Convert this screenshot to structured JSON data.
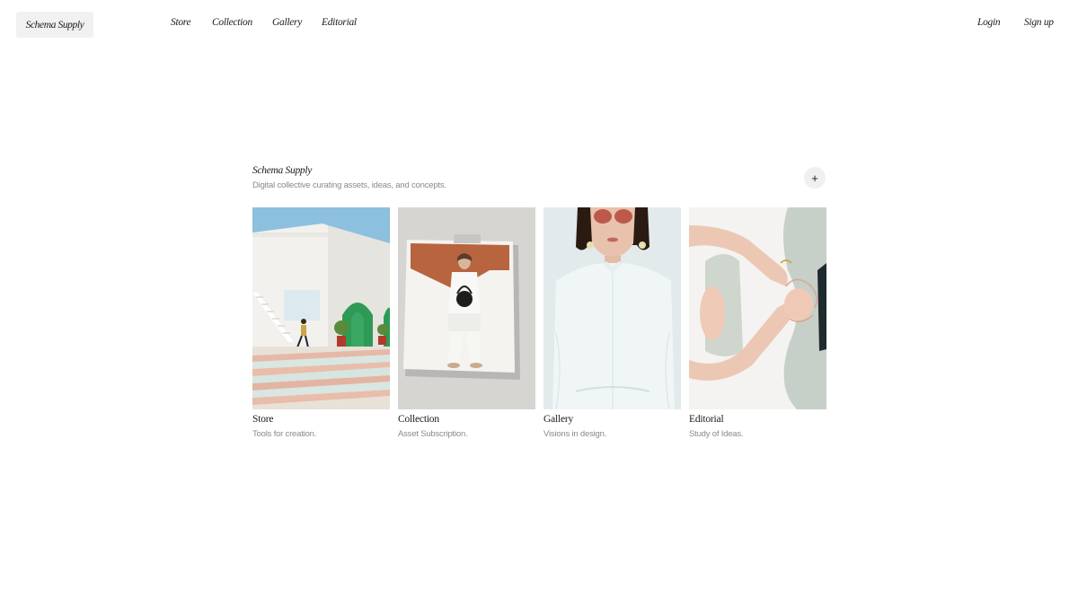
{
  "header": {
    "logo": "Schema Supply",
    "nav": [
      "Store",
      "Collection",
      "Gallery",
      "Editorial"
    ],
    "login": "Login",
    "signup": "Sign up"
  },
  "intro": {
    "title": "Schema Supply",
    "description": "Digital collective curating assets, ideas, and concepts.",
    "action_icon": "plus-icon",
    "action_symbol": "+"
  },
  "cards": [
    {
      "title": "Store",
      "subtitle": "Tools for creation.",
      "image": "architecture-photo"
    },
    {
      "title": "Collection",
      "subtitle": "Asset Subscription.",
      "image": "fashion-print-photo"
    },
    {
      "title": "Gallery",
      "subtitle": "Visions in design.",
      "image": "portrait-photo"
    },
    {
      "title": "Editorial",
      "subtitle": "Study of Ideas.",
      "image": "hands-photo"
    }
  ]
}
